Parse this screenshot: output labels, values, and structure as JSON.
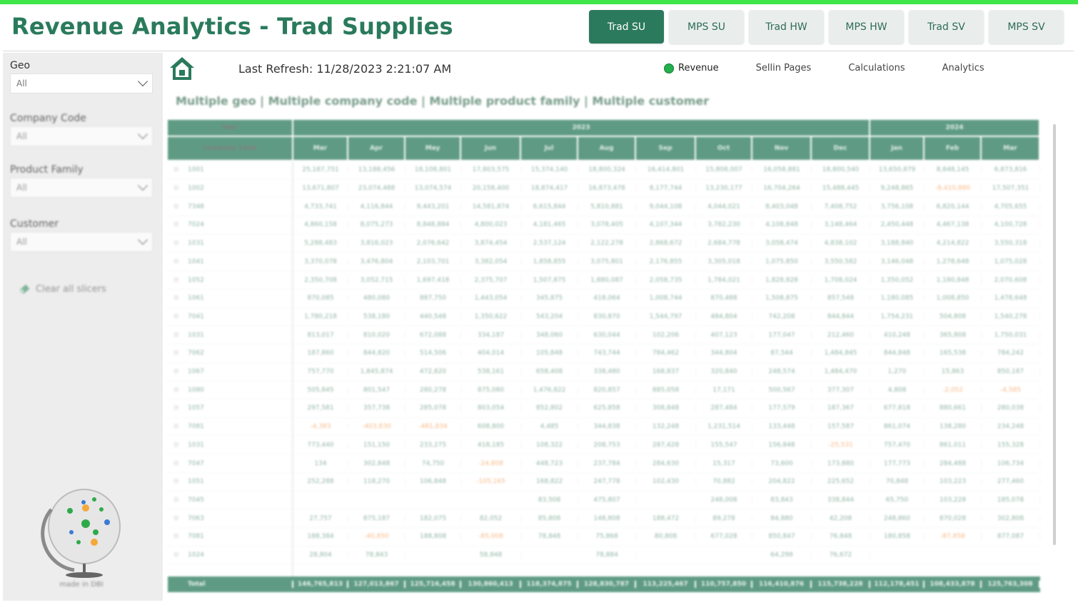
{
  "header": {
    "title": "Revenue Analytics - Trad Supplies",
    "nav_buttons": [
      {
        "label": "Trad SU",
        "active": true
      },
      {
        "label": "MPS SU",
        "active": false
      },
      {
        "label": "Trad HW",
        "active": false
      },
      {
        "label": "MPS HW",
        "active": false
      },
      {
        "label": "Trad SV",
        "active": false
      },
      {
        "label": "MPS SV",
        "active": false
      }
    ],
    "accent_color": "#2a7a5c"
  },
  "sidebar": {
    "slicers": [
      {
        "label": "Geo",
        "value": "All"
      },
      {
        "label": "Company Code",
        "value": "All"
      },
      {
        "label": "Product Family",
        "value": "All"
      },
      {
        "label": "Customer",
        "value": "All"
      }
    ],
    "clear_label": "Clear all slicers",
    "logo_caption": "made in DBI"
  },
  "main": {
    "refresh_text": "Last Refresh: 11/28/2023 2:21:07 AM",
    "page_tabs": [
      "Revenue",
      "Sellin Pages",
      "Calculations",
      "Analytics"
    ],
    "filter_summary": "Multiple geo | Multiple company code | Multiple product family | Multiple customer"
  },
  "matrix": {
    "year_header": "Year",
    "row_header": "Company Code",
    "years": [
      {
        "label": "2023",
        "span": 10
      },
      {
        "label": "2024",
        "span": 3
      }
    ],
    "months": [
      "Mar",
      "Apr",
      "May",
      "Jun",
      "Jul",
      "Aug",
      "Sep",
      "Oct",
      "Nov",
      "Dec",
      "Jan",
      "Feb",
      "Mar"
    ],
    "rows": [
      {
        "code": "1001",
        "values": [
          "25,187,751",
          "13,188,456",
          "18,108,801",
          "17,803,575",
          "15,374,140",
          "18,800,324",
          "16,414,801",
          "15,808,007",
          "16,058,881",
          "18,800,540",
          "13,650,879",
          "8,848,145",
          "6,873,816"
        ]
      },
      {
        "code": "1002",
        "values": [
          "13,671,807",
          "23,074,488",
          "13,074,574",
          "20,158,400",
          "18,874,417",
          "16,873,478",
          "8,177,744",
          "13,230,177",
          "16,704,264",
          "15,488,445",
          "9,248,865",
          "-8,410,880",
          "17,507,351"
        ]
      },
      {
        "code": "7348",
        "values": [
          "4,733,741",
          "4,116,844",
          "9,443,201",
          "14,581,874",
          "6,615,844",
          "5,810,881",
          "9,044,108",
          "4,044,021",
          "8,403,048",
          "7,408,752",
          "3,756,108",
          "6,820,144",
          "4,705,655"
        ]
      },
      {
        "code": "7024",
        "values": [
          "4,860,158",
          "8,075,273",
          "8,848,884",
          "4,800,023",
          "4,181,465",
          "3,078,405",
          "4,107,344",
          "3,782,230",
          "4,108,848",
          "3,148,464",
          "2,450,448",
          "4,467,138",
          "4,100,728"
        ]
      },
      {
        "code": "1031",
        "values": [
          "5,288,483",
          "3,816,023",
          "2,076,642",
          "3,874,454",
          "2,537,124",
          "2,122,278",
          "2,868,672",
          "2,684,778",
          "3,058,474",
          "4,838,102",
          "3,188,840",
          "4,214,822",
          "3,550,318"
        ]
      },
      {
        "code": "1041",
        "values": [
          "3,370,078",
          "3,476,804",
          "2,103,701",
          "3,382,054",
          "1,858,855",
          "3,075,801",
          "2,176,855",
          "3,305,018",
          "1,075,850",
          "3,550,582",
          "3,146,048",
          "1,278,648",
          "1,075,028"
        ]
      },
      {
        "code": "1052",
        "values": [
          "2,350,708",
          "3,052,715",
          "1,697,418",
          "2,375,707",
          "1,507,875",
          "1,880,087",
          "2,058,735",
          "1,784,021",
          "1,828,828",
          "1,708,024",
          "1,350,052",
          "1,180,848",
          "2,070,608"
        ]
      },
      {
        "code": "1061",
        "values": [
          "870,085",
          "480,080",
          "887,750",
          "1,443,054",
          "345,875",
          "418,064",
          "1,008,744",
          "870,488",
          "1,508,875",
          "857,548",
          "1,180,085",
          "1,008,850",
          "1,478,648"
        ]
      },
      {
        "code": "7041",
        "values": [
          "1,780,218",
          "538,180",
          "440,548",
          "1,350,622",
          "543,204",
          "830,870",
          "1,544,797",
          "484,804",
          "742,208",
          "844,844",
          "1,754,231",
          "504,808",
          "1,540,278"
        ]
      },
      {
        "code": "1031",
        "values": [
          "813,017",
          "810,020",
          "672,088",
          "334,187",
          "348,060",
          "630,044",
          "102,206",
          "407,123",
          "177,047",
          "212,460",
          "410,248",
          "365,808",
          "1,750,031"
        ]
      },
      {
        "code": "7062",
        "values": [
          "187,860",
          "844,820",
          "514,506",
          "404,014",
          "105,848",
          "743,744",
          "784,462",
          "344,804",
          "87,544",
          "1,484,845",
          "844,848",
          "165,538",
          "784,242"
        ]
      },
      {
        "code": "1067",
        "values": [
          "757,770",
          "1,845,874",
          "472,820",
          "538,161",
          "658,408",
          "338,480",
          "168,837",
          "320,840",
          "248,574",
          "1,484,470",
          "1,270",
          "15,863",
          "850,187"
        ]
      },
      {
        "code": "1080",
        "values": [
          "505,845",
          "801,547",
          "280,278",
          "875,080",
          "1,476,822",
          "820,857",
          "885,058",
          "17,171",
          "500,567",
          "377,307",
          "4,808",
          "-2,052",
          "-4,585"
        ]
      },
      {
        "code": "1057",
        "values": [
          "297,581",
          "357,738",
          "285,078",
          "803,054",
          "852,802",
          "625,858",
          "308,848",
          "287,484",
          "177,579",
          "187,367",
          "677,818",
          "880,661",
          "280,038"
        ]
      },
      {
        "code": "7081",
        "values": [
          "-4,383",
          "-403,830",
          "-481,834",
          "608,800",
          "4,485",
          "344,838",
          "132,248",
          "1,231,514",
          "133,448",
          "157,587",
          "861,074",
          "138,280",
          "234,248"
        ]
      },
      {
        "code": "1031",
        "values": [
          "773,440",
          "151,150",
          "233,275",
          "418,185",
          "108,322",
          "208,753",
          "287,428",
          "155,547",
          "156,848",
          "-25,531",
          "757,470",
          "861,011",
          "155,328"
        ]
      },
      {
        "code": "7047",
        "values": [
          "134",
          "302,848",
          "74,750",
          "-24,808",
          "448,723",
          "237,784",
          "284,630",
          "15,317",
          "73,600",
          "173,880",
          "177,773",
          "284,488",
          "106,734"
        ]
      },
      {
        "code": "1051",
        "values": [
          "252,288",
          "118,270",
          "106,848",
          "-105,165",
          "168,822",
          "247,778",
          "102,430",
          "70,882",
          "204,822",
          "225,652",
          "70,848",
          "103,223",
          "277,460"
        ]
      },
      {
        "code": "7045",
        "values": [
          "",
          "",
          "",
          "",
          "83,508",
          "475,807",
          "",
          "248,008",
          "83,843",
          "338,844",
          "65,750",
          "103,228",
          "185,078"
        ]
      },
      {
        "code": "7063",
        "values": [
          "27,757",
          "875,187",
          "182,075",
          "82,052",
          "85,808",
          "148,808",
          "188,472",
          "89,278",
          "84,880",
          "42,208",
          "248,860",
          "870,028",
          "302,808"
        ]
      },
      {
        "code": "7081",
        "values": [
          "188,384",
          "-40,850",
          "188,808",
          "-85,008",
          "78,848",
          "75,868",
          "80,808",
          "677,028",
          "850,847",
          "76,848",
          "180,858",
          "-87,858",
          "877,087"
        ]
      },
      {
        "code": "1024",
        "values": [
          "28,804",
          "78,843",
          "",
          "58,848",
          "",
          "78,884",
          "",
          "",
          "64,298",
          "76,672",
          "",
          "",
          ""
        ]
      }
    ],
    "total_label": "Total",
    "totals": [
      "146,765,813",
      "127,013,867",
      "125,716,458",
      "130,860,413",
      "118,374,875",
      "128,830,787",
      "113,225,467",
      "110,757,850",
      "116,410,876",
      "115,738,228",
      "112,178,451",
      "108,433,878",
      "125,763,308"
    ]
  }
}
